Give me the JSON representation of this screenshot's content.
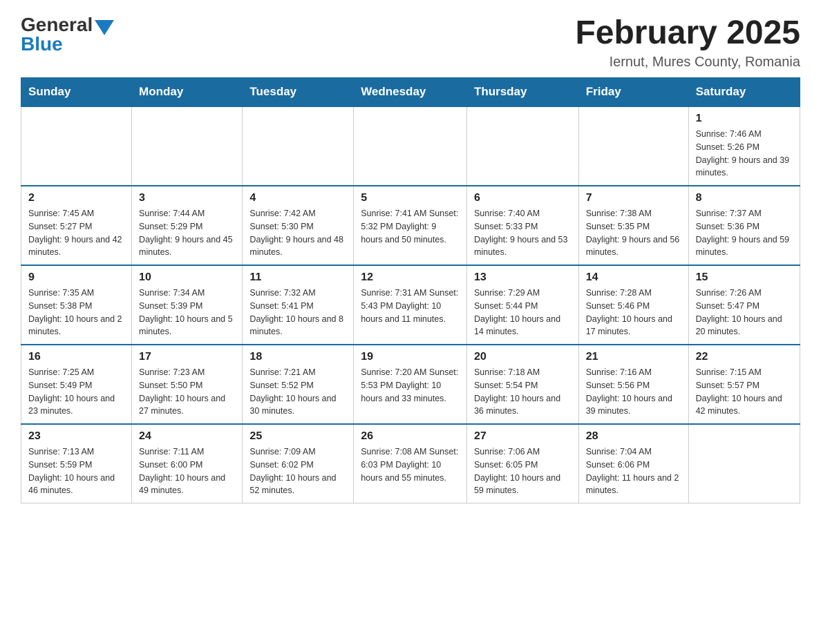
{
  "logo": {
    "general": "General",
    "blue": "Blue"
  },
  "title": {
    "month_year": "February 2025",
    "location": "Iernut, Mures County, Romania"
  },
  "weekdays": [
    "Sunday",
    "Monday",
    "Tuesday",
    "Wednesday",
    "Thursday",
    "Friday",
    "Saturday"
  ],
  "weeks": [
    [
      {
        "day": "",
        "info": ""
      },
      {
        "day": "",
        "info": ""
      },
      {
        "day": "",
        "info": ""
      },
      {
        "day": "",
        "info": ""
      },
      {
        "day": "",
        "info": ""
      },
      {
        "day": "",
        "info": ""
      },
      {
        "day": "1",
        "info": "Sunrise: 7:46 AM\nSunset: 5:26 PM\nDaylight: 9 hours and 39 minutes."
      }
    ],
    [
      {
        "day": "2",
        "info": "Sunrise: 7:45 AM\nSunset: 5:27 PM\nDaylight: 9 hours and 42 minutes."
      },
      {
        "day": "3",
        "info": "Sunrise: 7:44 AM\nSunset: 5:29 PM\nDaylight: 9 hours and 45 minutes."
      },
      {
        "day": "4",
        "info": "Sunrise: 7:42 AM\nSunset: 5:30 PM\nDaylight: 9 hours and 48 minutes."
      },
      {
        "day": "5",
        "info": "Sunrise: 7:41 AM\nSunset: 5:32 PM\nDaylight: 9 hours and 50 minutes."
      },
      {
        "day": "6",
        "info": "Sunrise: 7:40 AM\nSunset: 5:33 PM\nDaylight: 9 hours and 53 minutes."
      },
      {
        "day": "7",
        "info": "Sunrise: 7:38 AM\nSunset: 5:35 PM\nDaylight: 9 hours and 56 minutes."
      },
      {
        "day": "8",
        "info": "Sunrise: 7:37 AM\nSunset: 5:36 PM\nDaylight: 9 hours and 59 minutes."
      }
    ],
    [
      {
        "day": "9",
        "info": "Sunrise: 7:35 AM\nSunset: 5:38 PM\nDaylight: 10 hours and 2 minutes."
      },
      {
        "day": "10",
        "info": "Sunrise: 7:34 AM\nSunset: 5:39 PM\nDaylight: 10 hours and 5 minutes."
      },
      {
        "day": "11",
        "info": "Sunrise: 7:32 AM\nSunset: 5:41 PM\nDaylight: 10 hours and 8 minutes."
      },
      {
        "day": "12",
        "info": "Sunrise: 7:31 AM\nSunset: 5:43 PM\nDaylight: 10 hours and 11 minutes."
      },
      {
        "day": "13",
        "info": "Sunrise: 7:29 AM\nSunset: 5:44 PM\nDaylight: 10 hours and 14 minutes."
      },
      {
        "day": "14",
        "info": "Sunrise: 7:28 AM\nSunset: 5:46 PM\nDaylight: 10 hours and 17 minutes."
      },
      {
        "day": "15",
        "info": "Sunrise: 7:26 AM\nSunset: 5:47 PM\nDaylight: 10 hours and 20 minutes."
      }
    ],
    [
      {
        "day": "16",
        "info": "Sunrise: 7:25 AM\nSunset: 5:49 PM\nDaylight: 10 hours and 23 minutes."
      },
      {
        "day": "17",
        "info": "Sunrise: 7:23 AM\nSunset: 5:50 PM\nDaylight: 10 hours and 27 minutes."
      },
      {
        "day": "18",
        "info": "Sunrise: 7:21 AM\nSunset: 5:52 PM\nDaylight: 10 hours and 30 minutes."
      },
      {
        "day": "19",
        "info": "Sunrise: 7:20 AM\nSunset: 5:53 PM\nDaylight: 10 hours and 33 minutes."
      },
      {
        "day": "20",
        "info": "Sunrise: 7:18 AM\nSunset: 5:54 PM\nDaylight: 10 hours and 36 minutes."
      },
      {
        "day": "21",
        "info": "Sunrise: 7:16 AM\nSunset: 5:56 PM\nDaylight: 10 hours and 39 minutes."
      },
      {
        "day": "22",
        "info": "Sunrise: 7:15 AM\nSunset: 5:57 PM\nDaylight: 10 hours and 42 minutes."
      }
    ],
    [
      {
        "day": "23",
        "info": "Sunrise: 7:13 AM\nSunset: 5:59 PM\nDaylight: 10 hours and 46 minutes."
      },
      {
        "day": "24",
        "info": "Sunrise: 7:11 AM\nSunset: 6:00 PM\nDaylight: 10 hours and 49 minutes."
      },
      {
        "day": "25",
        "info": "Sunrise: 7:09 AM\nSunset: 6:02 PM\nDaylight: 10 hours and 52 minutes."
      },
      {
        "day": "26",
        "info": "Sunrise: 7:08 AM\nSunset: 6:03 PM\nDaylight: 10 hours and 55 minutes."
      },
      {
        "day": "27",
        "info": "Sunrise: 7:06 AM\nSunset: 6:05 PM\nDaylight: 10 hours and 59 minutes."
      },
      {
        "day": "28",
        "info": "Sunrise: 7:04 AM\nSunset: 6:06 PM\nDaylight: 11 hours and 2 minutes."
      },
      {
        "day": "",
        "info": ""
      }
    ]
  ]
}
